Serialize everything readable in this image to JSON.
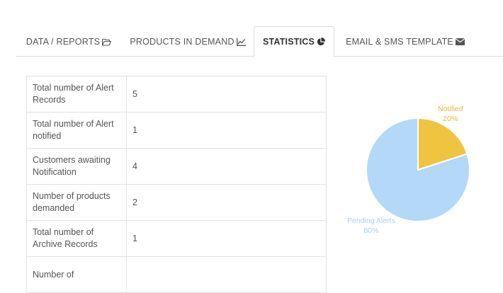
{
  "tabs": [
    {
      "label": "DATA / REPORTS",
      "icon": "folder-open-icon",
      "active": false
    },
    {
      "label": "PRODUCTS IN DEMAND",
      "icon": "line-chart-icon",
      "active": false
    },
    {
      "label": "STATISTICS",
      "icon": "pie-chart-icon",
      "active": true
    },
    {
      "label": "EMAIL & SMS TEMPLATE",
      "icon": "envelope-icon",
      "active": false
    }
  ],
  "stats": {
    "rows": [
      {
        "label": "Total number of Alert Records",
        "value": "5"
      },
      {
        "label": "Total number of Alert notified",
        "value": "1"
      },
      {
        "label": "Customers awaiting Notification",
        "value": "4"
      },
      {
        "label": "Number of products demanded",
        "value": "2"
      },
      {
        "label": "Total number of Archive Records",
        "value": "1"
      },
      {
        "label": "Number of",
        "value": ""
      }
    ]
  },
  "chart_data": {
    "type": "pie",
    "slices": [
      {
        "label": "Notified",
        "percent_label": "20%",
        "value": 20,
        "color": "#eec441"
      },
      {
        "label": "Pending Alerts",
        "percent_label": "80%",
        "value": 80,
        "color": "#b3d8f8"
      }
    ]
  },
  "colors": {
    "notified": "#eec441",
    "pending": "#b3d8f8",
    "border": "#dddddd"
  }
}
